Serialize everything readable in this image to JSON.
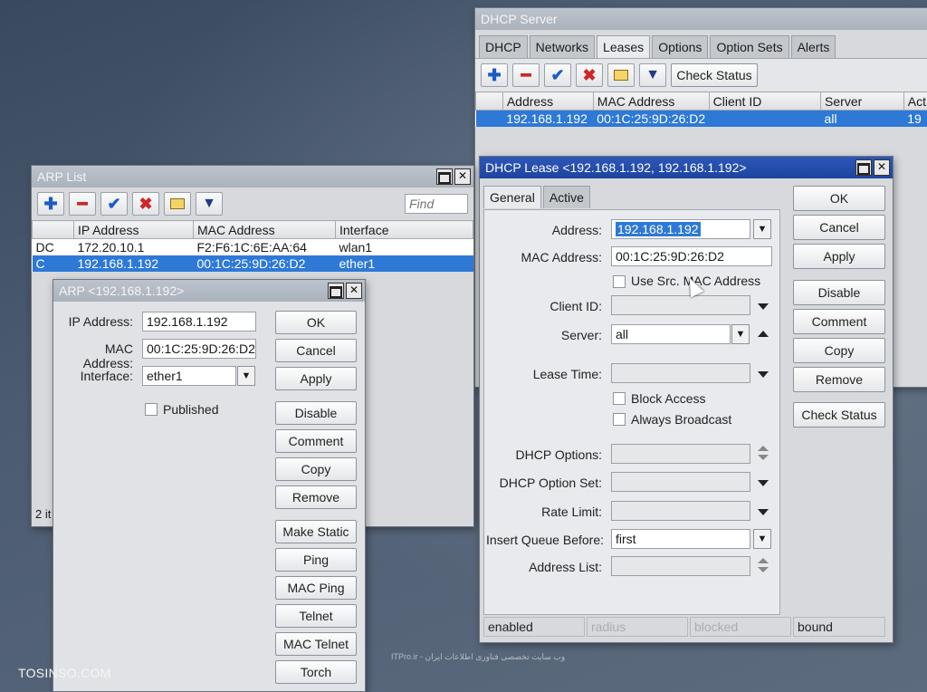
{
  "watermark": "TOSINSO.COM",
  "footer_text": "ITPro.ir - وب سایت تخصصی فناوری اطلاعات ایران",
  "dhcp_server": {
    "title": "DHCP Server",
    "tabs": [
      "DHCP",
      "Networks",
      "Leases",
      "Options",
      "Option Sets",
      "Alerts"
    ],
    "selected_tab": "Leases",
    "check_status": "Check Status",
    "columns": [
      "Address",
      "MAC Address",
      "Client ID",
      "Server",
      "Act"
    ],
    "rows": [
      {
        "address": "192.168.1.192",
        "mac": "00:1C:25:9D:26:D2",
        "client_id": "",
        "server": "all",
        "act": "19"
      }
    ]
  },
  "arp_list": {
    "title": "ARP List",
    "find_placeholder": "Find",
    "columns": [
      "",
      "IP Address",
      "MAC Address",
      "Interface"
    ],
    "rows": [
      {
        "flag": "DC",
        "ip": "172.20.10.1",
        "mac": "F2:F6:1C:6E:AA:64",
        "iface": "wlan1",
        "selected": false
      },
      {
        "flag": "C",
        "ip": "192.168.1.192",
        "mac": "00:1C:25:9D:26:D2",
        "iface": "ether1",
        "selected": true
      }
    ],
    "status": "2 it"
  },
  "arp_entry": {
    "title": "ARP <192.168.1.192>",
    "ip_label": "IP Address:",
    "ip_value": "192.168.1.192",
    "mac_label": "MAC Address:",
    "mac_value": "00:1C:25:9D:26:D2",
    "iface_label": "Interface:",
    "iface_value": "ether1",
    "published_label": "Published",
    "buttons": [
      "OK",
      "Cancel",
      "Apply",
      "Disable",
      "Comment",
      "Copy",
      "Remove",
      "Make Static",
      "Ping",
      "MAC Ping",
      "Telnet",
      "MAC Telnet",
      "Torch"
    ]
  },
  "dhcp_lease": {
    "title": "DHCP Lease <192.168.1.192, 192.168.1.192>",
    "tabs": [
      "General",
      "Active"
    ],
    "selected_tab": "General",
    "address_label": "Address:",
    "address_value": "192.168.1.192",
    "mac_label": "MAC Address:",
    "mac_value": "00:1C:25:9D:26:D2",
    "use_src_mac": "Use Src. MAC Address",
    "client_id_label": "Client ID:",
    "server_label": "Server:",
    "server_value": "all",
    "lease_time_label": "Lease Time:",
    "block_access": "Block Access",
    "always_broadcast": "Always Broadcast",
    "dhcp_options_label": "DHCP Options:",
    "dhcp_option_set_label": "DHCP Option Set:",
    "rate_limit_label": "Rate Limit:",
    "insert_queue_label": "Insert Queue Before:",
    "insert_queue_value": "first",
    "address_list_label": "Address List:",
    "buttons": [
      "OK",
      "Cancel",
      "Apply",
      "Disable",
      "Comment",
      "Copy",
      "Remove",
      "Check Status"
    ],
    "status": [
      "enabled",
      "radius",
      "blocked",
      "bound"
    ]
  },
  "colors": {
    "active_title": "#1e44a0",
    "selection": "#2e79d6"
  }
}
